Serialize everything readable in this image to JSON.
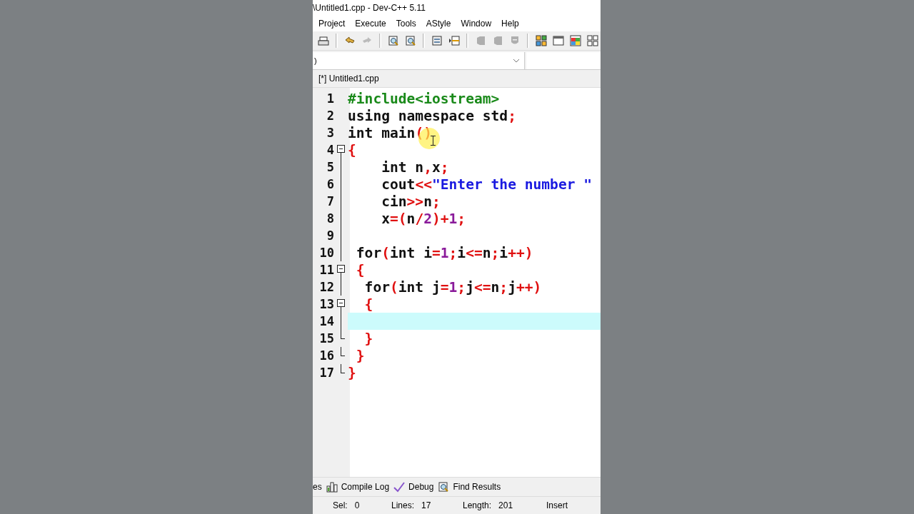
{
  "window": {
    "title": "\\Untitled1.cpp - Dev-C++ 5.11"
  },
  "menu": [
    "Project",
    "Execute",
    "Tools",
    "AStyle",
    "Window",
    "Help"
  ],
  "toolbar": [
    {
      "kind": "print",
      "disabled": false
    },
    {
      "kind": "sep"
    },
    {
      "kind": "undo",
      "disabled": false
    },
    {
      "kind": "redo",
      "disabled": true
    },
    {
      "kind": "sep"
    },
    {
      "kind": "find",
      "disabled": false
    },
    {
      "kind": "find",
      "disabled": false
    },
    {
      "kind": "sep"
    },
    {
      "kind": "panel",
      "disabled": false
    },
    {
      "kind": "indent",
      "disabled": false
    },
    {
      "kind": "sep"
    },
    {
      "kind": "tag",
      "disabled": true
    },
    {
      "kind": "tag",
      "disabled": true
    },
    {
      "kind": "shield",
      "disabled": true
    },
    {
      "kind": "sep"
    },
    {
      "kind": "tiles",
      "disabled": false
    },
    {
      "kind": "window",
      "disabled": false
    },
    {
      "kind": "colors",
      "disabled": false
    },
    {
      "kind": "grid",
      "disabled": false
    }
  ],
  "scope_box": {
    "value": ")"
  },
  "editor_tabs": [
    {
      "label": "[*] Untitled1.cpp",
      "selected": true
    }
  ],
  "code": [
    {
      "number": "1",
      "current": false,
      "tokens": [
        {
          "t": "#include<iostream>",
          "kind": "pre"
        }
      ]
    },
    {
      "number": "2",
      "current": false,
      "tokens": [
        {
          "t": "using namespace std",
          "kind": "plain"
        },
        {
          "t": ";",
          "kind": "sym"
        }
      ]
    },
    {
      "number": "3",
      "current": false,
      "tokens": [
        {
          "t": "int main",
          "kind": "plain"
        },
        {
          "t": "()",
          "kind": "sym"
        }
      ]
    },
    {
      "number": "4",
      "kind": "open",
      "current": false,
      "tokens": [
        {
          "t": "{",
          "kind": "sym"
        }
      ]
    },
    {
      "number": "5",
      "kind": "line",
      "current": false,
      "tokens": [
        {
          "t": "    int n",
          "kind": "plain"
        },
        {
          "t": ",",
          "kind": "sym"
        },
        {
          "t": "x",
          "kind": "plain"
        },
        {
          "t": ";",
          "kind": "sym"
        }
      ]
    },
    {
      "number": "6",
      "kind": "line",
      "current": false,
      "tokens": [
        {
          "t": "    cout",
          "kind": "plain"
        },
        {
          "t": "<<",
          "kind": "sym"
        },
        {
          "t": "\"Enter the number \"",
          "kind": "str"
        }
      ]
    },
    {
      "number": "7",
      "kind": "line",
      "current": false,
      "tokens": [
        {
          "t": "    cin",
          "kind": "plain"
        },
        {
          "t": ">>",
          "kind": "sym"
        },
        {
          "t": "n",
          "kind": "plain"
        },
        {
          "t": ";",
          "kind": "sym"
        }
      ]
    },
    {
      "number": "8",
      "kind": "line",
      "current": false,
      "tokens": [
        {
          "t": "    x",
          "kind": "plain"
        },
        {
          "t": "=(",
          "kind": "sym"
        },
        {
          "t": "n",
          "kind": "plain"
        },
        {
          "t": "/",
          "kind": "sym"
        },
        {
          "t": "2",
          "kind": "num"
        },
        {
          "t": ")+",
          "kind": "sym"
        },
        {
          "t": "1",
          "kind": "num"
        },
        {
          "t": ";",
          "kind": "sym"
        }
      ]
    },
    {
      "number": "9",
      "kind": "line",
      "current": false
    },
    {
      "number": "10",
      "kind": "line",
      "current": false,
      "tokens": [
        {
          "t": " for",
          "kind": "plain"
        },
        {
          "t": "(",
          "kind": "sym"
        },
        {
          "t": "int i",
          "kind": "plain"
        },
        {
          "t": "=",
          "kind": "sym"
        },
        {
          "t": "1",
          "kind": "num"
        },
        {
          "t": ";",
          "kind": "sym"
        },
        {
          "t": "i",
          "kind": "plain"
        },
        {
          "t": "<=",
          "kind": "sym"
        },
        {
          "t": "n",
          "kind": "plain"
        },
        {
          "t": ";",
          "kind": "sym"
        },
        {
          "t": "i",
          "kind": "plain"
        },
        {
          "t": "++)",
          "kind": "sym"
        }
      ]
    },
    {
      "number": "11",
      "kind": "open",
      "current": false,
      "tokens": [
        {
          "t": " {",
          "kind": "sym"
        }
      ]
    },
    {
      "number": "12",
      "kind": "line",
      "current": false,
      "tokens": [
        {
          "t": "  for",
          "kind": "plain"
        },
        {
          "t": "(",
          "kind": "sym"
        },
        {
          "t": "int j",
          "kind": "plain"
        },
        {
          "t": "=",
          "kind": "sym"
        },
        {
          "t": "1",
          "kind": "num"
        },
        {
          "t": ";",
          "kind": "sym"
        },
        {
          "t": "j",
          "kind": "plain"
        },
        {
          "t": "<=",
          "kind": "sym"
        },
        {
          "t": "n",
          "kind": "plain"
        },
        {
          "t": ";",
          "kind": "sym"
        },
        {
          "t": "j",
          "kind": "plain"
        },
        {
          "t": "++)",
          "kind": "sym"
        }
      ]
    },
    {
      "number": "13",
      "kind": "open",
      "current": false,
      "tokens": [
        {
          "t": "  {",
          "kind": "sym"
        }
      ]
    },
    {
      "number": "14",
      "kind": "line",
      "current": true
    },
    {
      "number": "15",
      "kind": "end",
      "current": false,
      "tokens": [
        {
          "t": "  }",
          "kind": "sym"
        }
      ]
    },
    {
      "number": "16",
      "kind": "end",
      "current": false,
      "tokens": [
        {
          "t": " }",
          "kind": "sym"
        }
      ]
    },
    {
      "number": "17",
      "kind": "end",
      "current": false,
      "tokens": [
        {
          "t": "}",
          "kind": "sym"
        }
      ]
    }
  ],
  "bottom_tabs": [
    {
      "label": "es"
    },
    {
      "label": "Compile Log"
    },
    {
      "label": "Debug"
    },
    {
      "label": "Find Results"
    }
  ],
  "status_bar": [
    {
      "label": "Sel:",
      "value": "0"
    },
    {
      "label": "Lines:",
      "value": "17"
    },
    {
      "label": "Length:",
      "value": "201"
    },
    {
      "value": "Insert"
    }
  ]
}
